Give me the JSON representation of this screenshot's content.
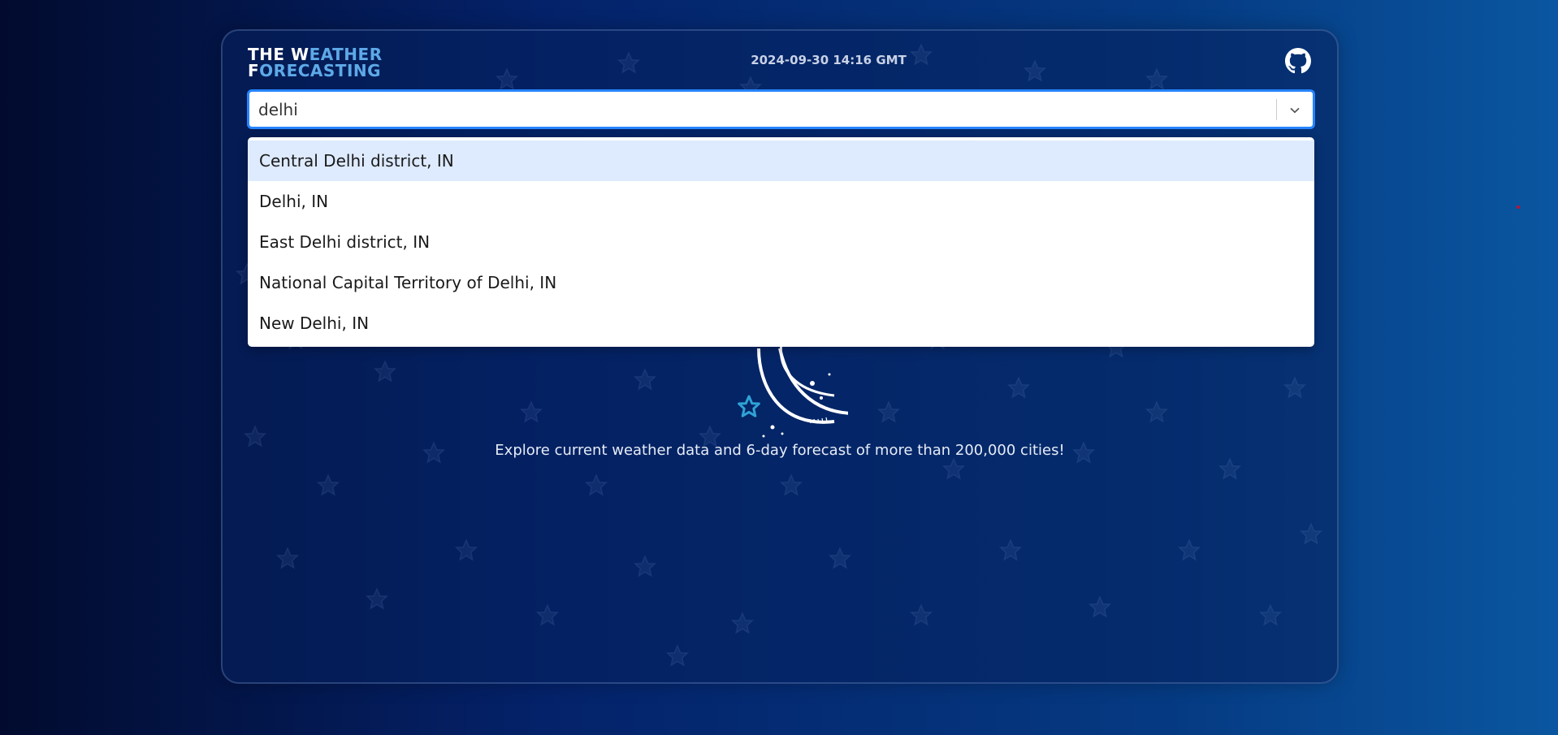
{
  "header": {
    "logo_line1_a": "THE W",
    "logo_line1_b": "EATHER",
    "logo_line2_a": "F",
    "logo_line2_b": "ORECASTING",
    "datetime": "2024-09-30 14:16 GMT",
    "github_icon": "github-icon"
  },
  "search": {
    "value": "delhi",
    "dropdown_icon": "chevron-down-icon"
  },
  "dropdown": {
    "options": [
      "Central Delhi district, IN",
      "Delhi, IN",
      "East Delhi district, IN",
      "National Capital Territory of Delhi, IN",
      "New Delhi, IN"
    ],
    "focused_index": 0
  },
  "main": {
    "illustration": "moon-and-stars-illustration",
    "tagline": "Explore current weather data and 6-day forecast of more than 200,000 cities!"
  },
  "colors": {
    "accent": "#5ea9e8",
    "input_border": "#2684ff",
    "option_focus": "#deebff"
  }
}
